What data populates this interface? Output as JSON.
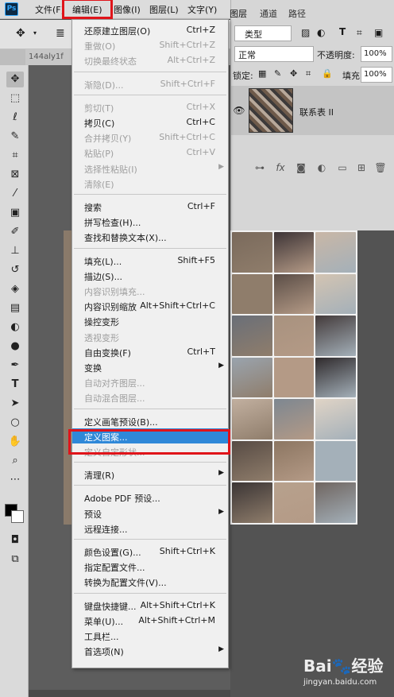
{
  "menubar": {
    "logo": "Ps",
    "menus": [
      "文件(F)",
      "编辑(E)",
      "图像(I)",
      "图层(L)",
      "文字(Y)"
    ]
  },
  "doc_tab": "144aly1f",
  "toolbar_icons": [
    "move-icon",
    "marquee-icon",
    "lasso-icon",
    "quick-select-icon",
    "crop-icon",
    "frame-icon",
    "eyedropper-icon",
    "healing-brush-icon",
    "brush-icon",
    "clone-stamp-icon",
    "history-brush-icon",
    "eraser-icon",
    "gradient-icon",
    "blur-icon",
    "dodge-icon",
    "pen-icon",
    "type-icon",
    "path-select-icon",
    "ellipse-icon",
    "hand-icon",
    "zoom-icon",
    "more-icon"
  ],
  "layers_panel": {
    "tabs": [
      "图层",
      "通道",
      "路径"
    ],
    "kind_filter": "类型",
    "blend_mode": "正常",
    "opacity_label": "不透明度:",
    "opacity_value": "100%",
    "lock_label": "锁定:",
    "fill_label": "填充:",
    "fill_value": "100%",
    "layer_name": "联系表 II"
  },
  "edit_menu": {
    "items": [
      {
        "label": "还原建立图层(O)",
        "shortcut": "Ctrl+Z",
        "disabled": false
      },
      {
        "label": "重做(O)",
        "shortcut": "Shift+Ctrl+Z",
        "disabled": true
      },
      {
        "label": "切换最终状态",
        "shortcut": "Alt+Ctrl+Z",
        "disabled": true
      },
      {
        "label": "渐隐(D)...",
        "shortcut": "Shift+Ctrl+F",
        "disabled": true
      },
      {
        "label": "剪切(T)",
        "shortcut": "Ctrl+X",
        "disabled": true
      },
      {
        "label": "拷贝(C)",
        "shortcut": "Ctrl+C",
        "disabled": false
      },
      {
        "label": "合并拷贝(Y)",
        "shortcut": "Shift+Ctrl+C",
        "disabled": true
      },
      {
        "label": "粘贴(P)",
        "shortcut": "Ctrl+V",
        "disabled": true
      },
      {
        "label": "选择性粘贴(I)",
        "shortcut": "",
        "disabled": true,
        "submenu": true
      },
      {
        "label": "清除(E)",
        "shortcut": "",
        "disabled": true
      },
      {
        "label": "搜索",
        "shortcut": "Ctrl+F",
        "disabled": false
      },
      {
        "label": "拼写检查(H)...",
        "shortcut": "",
        "disabled": false
      },
      {
        "label": "查找和替换文本(X)...",
        "shortcut": "",
        "disabled": false
      },
      {
        "label": "填充(L)...",
        "shortcut": "Shift+F5",
        "disabled": false
      },
      {
        "label": "描边(S)...",
        "shortcut": "",
        "disabled": false
      },
      {
        "label": "内容识别填充...",
        "shortcut": "",
        "disabled": true
      },
      {
        "label": "内容识别缩放",
        "shortcut": "Alt+Shift+Ctrl+C",
        "disabled": false
      },
      {
        "label": "操控变形",
        "shortcut": "",
        "disabled": false
      },
      {
        "label": "透视变形",
        "shortcut": "",
        "disabled": true
      },
      {
        "label": "自由变换(F)",
        "shortcut": "Ctrl+T",
        "disabled": false
      },
      {
        "label": "变换",
        "shortcut": "",
        "disabled": false,
        "submenu": true
      },
      {
        "label": "自动对齐图层...",
        "shortcut": "",
        "disabled": true
      },
      {
        "label": "自动混合图层...",
        "shortcut": "",
        "disabled": true
      },
      {
        "label": "定义画笔预设(B)...",
        "shortcut": "",
        "disabled": false
      },
      {
        "label": "定义图案...",
        "shortcut": "",
        "disabled": false,
        "highlighted": true
      },
      {
        "label": "定义自定形状...",
        "shortcut": "",
        "disabled": true
      },
      {
        "label": "清理(R)",
        "shortcut": "",
        "disabled": false,
        "submenu": true
      },
      {
        "label": "Adobe PDF 预设...",
        "shortcut": "",
        "disabled": false
      },
      {
        "label": "预设",
        "shortcut": "",
        "disabled": false,
        "submenu": true
      },
      {
        "label": "远程连接...",
        "shortcut": "",
        "disabled": false
      },
      {
        "label": "颜色设置(G)...",
        "shortcut": "Shift+Ctrl+K",
        "disabled": false
      },
      {
        "label": "指定配置文件...",
        "shortcut": "",
        "disabled": false
      },
      {
        "label": "转换为配置文件(V)...",
        "shortcut": "",
        "disabled": false
      },
      {
        "label": "键盘快捷键...",
        "shortcut": "Alt+Shift+Ctrl+K",
        "disabled": false
      },
      {
        "label": "菜单(U)...",
        "shortcut": "Alt+Shift+Ctrl+M",
        "disabled": false
      },
      {
        "label": "工具栏...",
        "shortcut": "",
        "disabled": false
      },
      {
        "label": "首选项(N)",
        "shortcut": "",
        "disabled": false,
        "submenu": true
      }
    ]
  },
  "watermark": {
    "logo": "Bai🐾经验",
    "url": "jingyan.baidu.com"
  },
  "colors": {
    "highlight": "#2f88d8",
    "annotation_red": "#e0141a",
    "menu_bg": "#f0f0f0"
  }
}
